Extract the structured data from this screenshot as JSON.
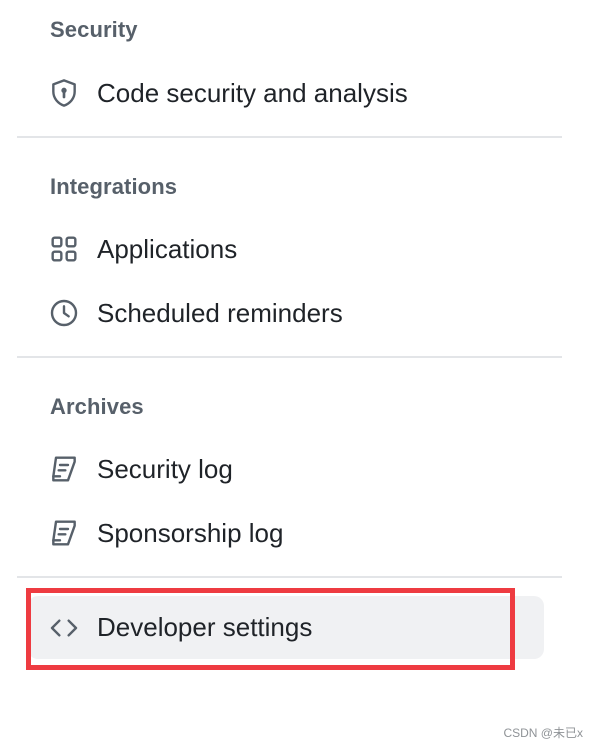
{
  "sections": [
    {
      "heading": "Security",
      "items": [
        {
          "label": "Code security and analysis",
          "icon": "shield-lock-icon"
        }
      ]
    },
    {
      "heading": "Integrations",
      "items": [
        {
          "label": "Applications",
          "icon": "apps-grid-icon"
        },
        {
          "label": "Scheduled reminders",
          "icon": "clock-icon"
        }
      ]
    },
    {
      "heading": "Archives",
      "items": [
        {
          "label": "Security log",
          "icon": "log-icon"
        },
        {
          "label": "Sponsorship log",
          "icon": "log-icon"
        }
      ]
    }
  ],
  "developer": {
    "label": "Developer settings",
    "icon": "code-icon",
    "hovered": true
  },
  "annotation": {
    "color": "#ee3b41"
  },
  "watermark": "CSDN @未已x",
  "colors": {
    "text": "#1f2328",
    "muted": "#57606a",
    "hover_bg": "#f0f1f3",
    "divider": "#e3e5e8"
  }
}
